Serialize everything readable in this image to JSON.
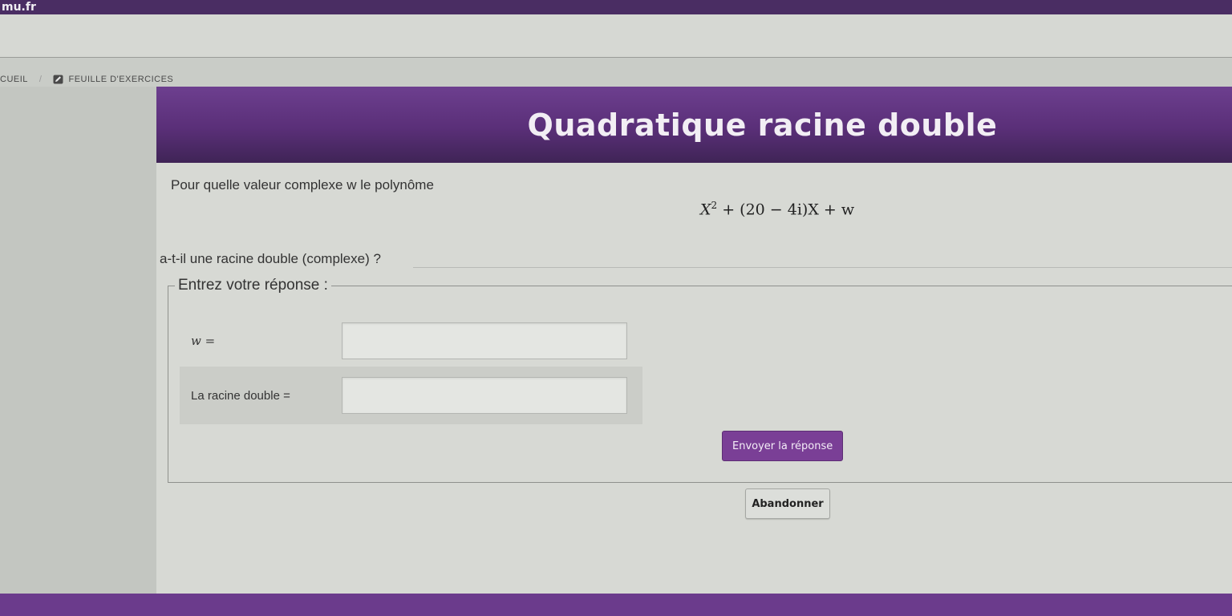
{
  "site": {
    "name": "mu.fr"
  },
  "breadcrumb": {
    "home_label": "CUEIL",
    "current_label": "FEUILLE D'EXERCICES",
    "current_icon": "pencil-icon"
  },
  "exercise": {
    "title": "Quadratique racine double",
    "question_intro": "Pour quelle valeur complexe w le polynôme",
    "formula_base": "X",
    "formula_exp": "2",
    "formula_rest": " + (20 − 4i)X + w",
    "question_end": "a-t-il une racine double (complexe) ?"
  },
  "answer": {
    "legend": "Entrez votre réponse :",
    "fields": [
      {
        "label": "w =",
        "value": ""
      },
      {
        "label": "La racine double =",
        "value": ""
      }
    ],
    "submit_label": "Envoyer la réponse",
    "abandon_label": "Abandonner"
  },
  "colors": {
    "accent": "#6d3f8f",
    "banner_dark": "#3f2456",
    "button": "#7a3f96"
  }
}
